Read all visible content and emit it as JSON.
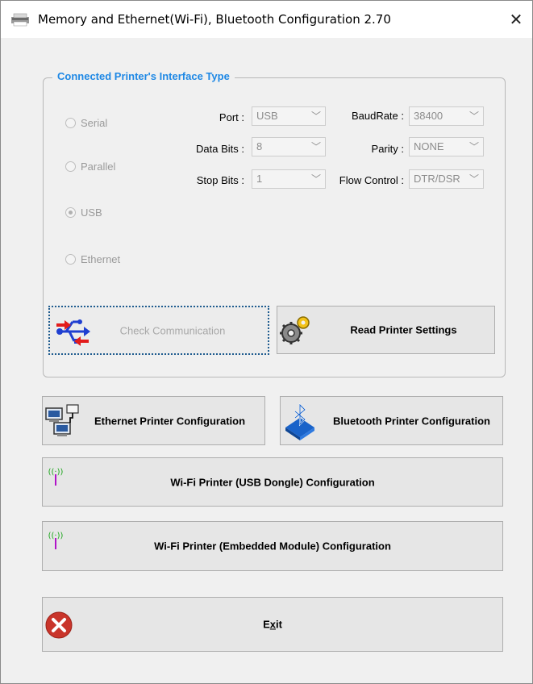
{
  "window": {
    "title": "Memory and Ethernet(Wi-Fi), Bluetooth Configuration 2.70",
    "close_label": "✕"
  },
  "group": {
    "title": "Connected Printer's Interface Type",
    "radios": [
      {
        "label": "Serial",
        "checked": false
      },
      {
        "label": "Parallel",
        "checked": false
      },
      {
        "label": "USB",
        "checked": true
      },
      {
        "label": "Ethernet",
        "checked": false
      }
    ],
    "fields": {
      "port": {
        "label": "Port :",
        "value": "USB"
      },
      "data_bits": {
        "label": "Data Bits :",
        "value": "8"
      },
      "stop_bits": {
        "label": "Stop Bits :",
        "value": "1"
      },
      "baud_rate": {
        "label": "BaudRate :",
        "value": "38400"
      },
      "parity": {
        "label": "Parity :",
        "value": "NONE"
      },
      "flow_control": {
        "label": "Flow Control :",
        "value": "DTR/DSR"
      }
    },
    "check_communication_label": "Check Communication",
    "read_settings_label": "Read Printer Settings"
  },
  "buttons": {
    "ethernet_config": "Ethernet Printer Configuration",
    "bluetooth_config": "Bluetooth Printer Configuration",
    "wifi_usb_config": "Wi-Fi Printer (USB Dongle) Configuration",
    "wifi_embedded_config": "Wi-Fi Printer (Embedded Module) Configuration",
    "exit_prefix": "E",
    "exit_mnemonic": "x",
    "exit_suffix": "it"
  },
  "icons": {
    "app": "printer-app-icon",
    "usb": "usb-icon",
    "gears": "gears-icon",
    "network": "network-computers-icon",
    "bluetooth": "bluetooth-icon",
    "wifi": "wifi-antenna-icon",
    "exit": "exit-icon"
  }
}
